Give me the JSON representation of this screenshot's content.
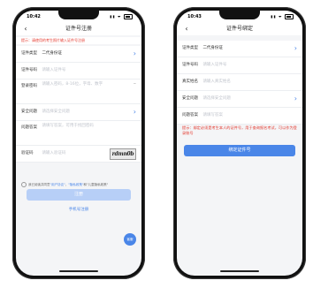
{
  "left": {
    "status_time": "10:42",
    "status_icons": "▮▮ ᯤ",
    "title": "证件号注册",
    "back_icon": "chevron-left-icon",
    "hint": "提示：请使用的考生照片输入证件号注册",
    "rows": [
      {
        "label": "证件类型",
        "value": "二代身份证",
        "placeholder": ""
      },
      {
        "label": "证件号码",
        "value": "",
        "placeholder": "请输入证件号"
      },
      {
        "label": "登录密码",
        "value": "",
        "placeholder": "请输入密码，8-16位，字母、数字"
      },
      {
        "label": "安全问题",
        "value": "",
        "placeholder": "请选择安全问题"
      },
      {
        "label": "问题答案",
        "value": "",
        "placeholder": "请填写答案，可用于找回密码"
      },
      {
        "label": "验证码",
        "value": "",
        "placeholder": "请输入验证码"
      }
    ],
    "captcha_text": "rdmn0b",
    "agree_prefix": "我已阅读并同意",
    "agree_link1": "\"用户协议\"",
    "agree_mid": "、",
    "agree_link2": "\"隐私政策\"",
    "agree_suffix": "和\"儿童隐私政策\"",
    "submit_label": "注册",
    "phone_register_link": "手机号注册",
    "fab_label": "客服"
  },
  "right": {
    "status_time": "10:43",
    "status_icons": "▮▮ ᯤ",
    "title": "证件号绑定",
    "rows": [
      {
        "label": "证件类型",
        "value": "二代身份证",
        "placeholder": ""
      },
      {
        "label": "证件号码",
        "value": "",
        "placeholder": "请输入证件号"
      },
      {
        "label": "真实姓名",
        "value": "",
        "placeholder": "请输入真实姓名"
      },
      {
        "label": "安全问题",
        "value": "",
        "placeholder": "请选择安全问题"
      },
      {
        "label": "问题答案",
        "value": "",
        "placeholder": "请填写答案"
      }
    ],
    "warning": "提示：绑定必须是考生本人的证件号，用于查询报名考试，可以作为登录账号",
    "submit_label": "绑定证件号"
  },
  "colors": {
    "accent": "#4a86e8",
    "accent_disabled": "#b7cff7",
    "warning": "#e4382d"
  }
}
